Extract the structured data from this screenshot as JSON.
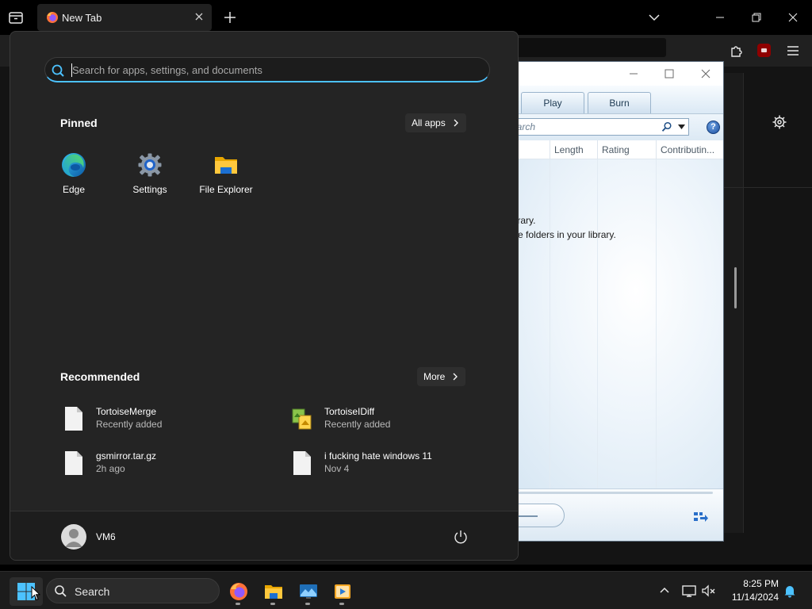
{
  "browser": {
    "tab_title": "New Tab",
    "colors": {
      "tab_bg": "#202020",
      "toolbar_bg": "#202020",
      "content_bg": "#141414"
    },
    "icons": [
      "tab-list-icon",
      "firefox-favicon-icon",
      "close-icon",
      "plus-icon",
      "chevron-down-icon",
      "minimize-icon",
      "restore-icon",
      "close-icon",
      "extensions-icon",
      "ublock-icon",
      "hamburger-menu-icon",
      "gear-icon"
    ]
  },
  "media_player": {
    "tabs": [
      "Play",
      "Burn"
    ],
    "search_placeholder": "Search",
    "help_label": "?",
    "columns": [
      "Length",
      "Rating",
      "Contributin..."
    ],
    "message_lines": [
      "c library.",
      "clude folders in your library."
    ]
  },
  "start_menu": {
    "search_placeholder": "Search for apps, settings, and documents",
    "pinned_heading": "Pinned",
    "all_apps_label": "All apps",
    "pinned_apps": [
      {
        "label": "Edge",
        "icon": "edge-icon"
      },
      {
        "label": "Settings",
        "icon": "settings-gear-icon"
      },
      {
        "label": "File Explorer",
        "icon": "folder-icon"
      }
    ],
    "recommended_heading": "Recommended",
    "more_label": "More",
    "recommended": [
      {
        "name": "TortoiseMerge",
        "detail": "Recently added",
        "icon": "document-icon"
      },
      {
        "name": "TortoiseIDiff",
        "detail": "Recently added",
        "icon": "tortoise-idiff-icon"
      },
      {
        "name": "gsmirror.tar.gz",
        "detail": "2h ago",
        "icon": "document-icon"
      },
      {
        "name": "i fucking hate windows 11",
        "detail": "Nov 4",
        "icon": "document-icon"
      }
    ],
    "user_name": "VM6",
    "accent_color": "#4cc2ff"
  },
  "taskbar": {
    "search_label": "Search",
    "apps": [
      "firefox-icon",
      "file-explorer-icon",
      "remote-desktop-icon",
      "media-player-icon"
    ],
    "time": "8:25 PM",
    "date": "11/14/2024"
  }
}
